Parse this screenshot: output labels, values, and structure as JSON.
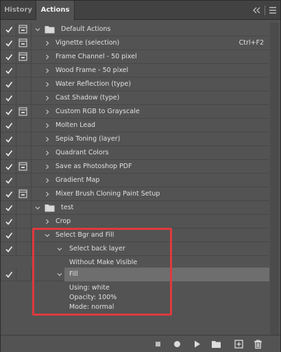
{
  "tabs": [
    {
      "label": "History",
      "active": false
    },
    {
      "label": "Actions",
      "active": true
    }
  ],
  "rows": [
    {
      "label": "Default Actions",
      "type": "set",
      "checked": true,
      "dialog": true,
      "expanded": true
    },
    {
      "label": "Vignette (selection)",
      "type": "action",
      "checked": true,
      "dialog": true,
      "expanded": false,
      "shortcut": "Ctrl+F2"
    },
    {
      "label": "Frame Channel - 50 pixel",
      "type": "action",
      "checked": true,
      "dialog": true,
      "expanded": false
    },
    {
      "label": "Wood Frame - 50 pixel",
      "type": "action",
      "checked": true,
      "dialog": false,
      "expanded": false
    },
    {
      "label": "Water Reflection (type)",
      "type": "action",
      "checked": true,
      "dialog": false,
      "expanded": false
    },
    {
      "label": "Cast Shadow (type)",
      "type": "action",
      "checked": true,
      "dialog": false,
      "expanded": false
    },
    {
      "label": "Custom RGB to Grayscale",
      "type": "action",
      "checked": true,
      "dialog": true,
      "expanded": false
    },
    {
      "label": "Molten Lead",
      "type": "action",
      "checked": true,
      "dialog": false,
      "expanded": false
    },
    {
      "label": "Sepia Toning (layer)",
      "type": "action",
      "checked": true,
      "dialog": false,
      "expanded": false
    },
    {
      "label": "Quadrant Colors",
      "type": "action",
      "checked": true,
      "dialog": false,
      "expanded": false
    },
    {
      "label": "Save as Photoshop PDF",
      "type": "action",
      "checked": true,
      "dialog": true,
      "expanded": false
    },
    {
      "label": "Gradient Map",
      "type": "action",
      "checked": true,
      "dialog": false,
      "expanded": false
    },
    {
      "label": "Mixer Brush Cloning Paint Setup",
      "type": "action",
      "checked": true,
      "dialog": true,
      "expanded": false
    },
    {
      "label": "test",
      "type": "set",
      "checked": true,
      "dialog": false,
      "expanded": true
    },
    {
      "label": "Crop",
      "type": "action",
      "checked": true,
      "dialog": false,
      "expanded": false
    },
    {
      "label": "Select Bgr and Fill",
      "type": "action",
      "checked": true,
      "dialog": false,
      "expanded": true
    },
    {
      "label": "Select back layer",
      "type": "step",
      "checked": true,
      "dialog": false,
      "expanded": true
    },
    {
      "label": "Without Make Visible",
      "type": "detail",
      "checked": false,
      "dialog": false
    },
    {
      "label": "Fill",
      "type": "step",
      "checked": true,
      "dialog": false,
      "expanded": true,
      "highlighted": true
    }
  ],
  "fill_details": [
    "Using: white",
    "Opacity: 100%",
    "Mode: normal"
  ],
  "toolbar_icons": [
    "stop-icon",
    "record-icon",
    "play-icon",
    "new-set-folder-icon",
    "new-action-icon",
    "delete-trash-icon"
  ],
  "colors": {
    "panel_bg": "#535353",
    "highlight": "#6e6e6e",
    "annotation": "#e0393e"
  }
}
